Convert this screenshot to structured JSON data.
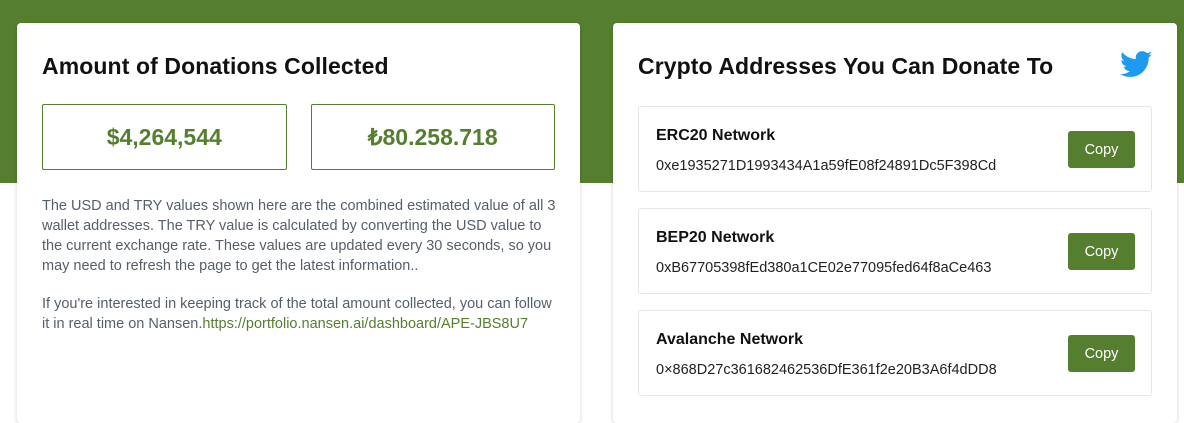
{
  "donations": {
    "title": "Amount of Donations Collected",
    "usd_amount": "$4,264,544",
    "try_amount": "₺80.258.718",
    "description": "The USD and TRY values shown here are the combined estimated value of all 3 wallet addresses. The TRY value is calculated by converting the USD value to the current exchange rate. These values are updated every 30 seconds, so you may need to refresh the page to get the latest information..",
    "tracking_text": "If you're interested in keeping track of the total amount collected, you can follow it in real time on Nansen.",
    "tracking_link": "https://portfolio.nansen.ai/dashboard/APE-JBS8U7"
  },
  "crypto": {
    "title": "Crypto Addresses You Can Donate To",
    "twitter_icon": "twitter-icon",
    "networks": [
      {
        "name": "ERC20 Network",
        "address": "0xe1935271D1993434A1a59fE08f24891Dc5F398Cd",
        "copy_label": "Copy"
      },
      {
        "name": "BEP20 Network",
        "address": "0xB67705398fEd380a1CE02e77095fed64f8aCe463",
        "copy_label": "Copy"
      },
      {
        "name": "Avalanche Network",
        "address": "0×868D27c361682462536DfE361f2e20B3A6f4dDD8",
        "copy_label": "Copy"
      }
    ]
  },
  "colors": {
    "brand_green": "#557f2f",
    "twitter_blue": "#1d9bf0"
  }
}
